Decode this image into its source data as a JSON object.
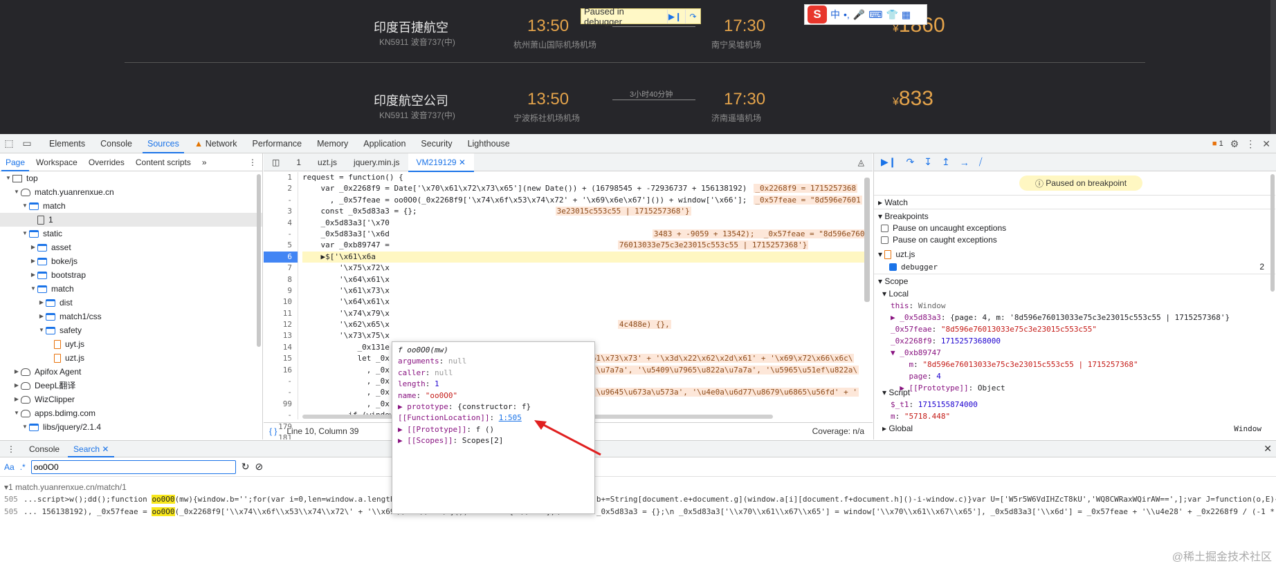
{
  "webpage": {
    "flights": [
      {
        "airline": "印度百捷航空",
        "flight_no": "KN5911 波音737(中)",
        "dep_time": "13:50",
        "dep_airport": "杭州萧山国际机场机场",
        "arr_time": "17:30",
        "arr_airport": "南宁吴墟机场",
        "duration": "",
        "price": "1860"
      },
      {
        "airline": "印度航空公司",
        "flight_no": "KN5911 波音737(中)",
        "dep_time": "13:50",
        "dep_airport": "宁波栎社机场机场",
        "arr_time": "17:30",
        "arr_airport": "济南遥墙机场",
        "duration": "3小时40分钟",
        "price": "833"
      }
    ],
    "price_symbol": "¥",
    "paused_banner": "Paused in debugger",
    "ime": {
      "logo": "S",
      "lang": "中",
      "punct": "•,"
    }
  },
  "devtools": {
    "tabs": [
      "Elements",
      "Console",
      "Sources",
      "Network",
      "Performance",
      "Memory",
      "Application",
      "Security",
      "Lighthouse"
    ],
    "issues_count": "1",
    "nav_tabs": [
      "Page",
      "Workspace",
      "Overrides",
      "Content scripts"
    ],
    "tree": [
      {
        "label": "top",
        "depth": 0,
        "type": "top",
        "open": true
      },
      {
        "label": "match.yuanrenxue.cn",
        "depth": 1,
        "type": "cloud",
        "open": true
      },
      {
        "label": "match",
        "depth": 2,
        "type": "folder",
        "open": true
      },
      {
        "label": "1",
        "depth": 3,
        "type": "file",
        "sel": true
      },
      {
        "label": "static",
        "depth": 2,
        "type": "folder",
        "open": true
      },
      {
        "label": "asset",
        "depth": 3,
        "type": "folder",
        "open": false
      },
      {
        "label": "boke/js",
        "depth": 3,
        "type": "folder",
        "open": false
      },
      {
        "label": "bootstrap",
        "depth": 3,
        "type": "folder",
        "open": false
      },
      {
        "label": "match",
        "depth": 3,
        "type": "folder",
        "open": true
      },
      {
        "label": "dist",
        "depth": 4,
        "type": "folder",
        "open": false
      },
      {
        "label": "match1/css",
        "depth": 4,
        "type": "folder",
        "open": false
      },
      {
        "label": "safety",
        "depth": 4,
        "type": "folder",
        "open": true
      },
      {
        "label": "uyt.js",
        "depth": 5,
        "type": "js"
      },
      {
        "label": "uzt.js",
        "depth": 5,
        "type": "js"
      },
      {
        "label": "Apifox Agent",
        "depth": 1,
        "type": "cloud",
        "open": false
      },
      {
        "label": "DeepL翻译",
        "depth": 1,
        "type": "cloud",
        "open": false
      },
      {
        "label": "WizClipper",
        "depth": 1,
        "type": "cloud",
        "open": false
      },
      {
        "label": "apps.bdimg.com",
        "depth": 1,
        "type": "cloud",
        "open": true
      },
      {
        "label": "libs/jquery/2.1.4",
        "depth": 2,
        "type": "folder",
        "open": true
      }
    ],
    "editor_tabs": [
      "1",
      "uzt.js",
      "jquery.min.js",
      "VM219129"
    ],
    "gutter": [
      "1",
      "2",
      "-",
      "3",
      "4",
      "-",
      "5",
      "6",
      "7",
      "8",
      "9",
      "10",
      "11",
      "12",
      "13",
      "14",
      "15",
      "16",
      "-",
      "-",
      "99",
      "-",
      "179",
      "181",
      "182"
    ],
    "code": [
      "request = function() {",
      "    var _0x2268f9 = Date['\\x70\\x61\\x72\\x73\\x65'](new Date()) + (16798545 + -72936737 + 156138192)",
      "      , _0x57feae = oo0O0(_0x2268f9['\\x74\\x6f\\x53\\x74\\x72' + '\\x69\\x6e\\x67']()) + window['\\x66'];",
      "    const _0x5d83a3 = {};",
      "    _0x5d83a3['\\x70",
      "    _0x5d83a3['\\x6d",
      "    var _0xb89747 =",
      "    ▶$['\\x61\\x6a",
      "        '\\x75\\x72\\x",
      "        '\\x64\\x61\\x",
      "        '\\x61\\x73\\x",
      "        '\\x64\\x61\\x",
      "        '\\x74\\x79\\x",
      "        '\\x62\\x65\\x",
      "        '\\x73\\x75\\x",
      "            _0x131e",
      "            let _0x",
      "              , _0x",
      "              , _0x",
      "              , _0x",
      "              , _0x",
      "          if (window['\\x70\\x61\\x67\\x65']) {} else",
      "              window['\\x70\\x61\\x67\\x65'] = 2333 * 3 + 458 * -5 + -4708;",
      "          $['\\x65\\x61\\x63\\x68'](_0x131e59, function(_0x282f1d, _0x4e0853) {"
    ],
    "inline_values": {
      "l2": "_0x2268f9 = 1715257368",
      "l3": "_0x57feae = \"8d596e7601",
      "l4": "3e23015c553c55 | 1715257368'}",
      "l6": "3483 + -9059 + 13542);  _0x57feae = \"8d596e76013033e75c3c",
      "l7": "76013033e75c3e23015c553c55 | 1715257368'}",
      "l15": "4c488e) {},",
      "l17": "61\\x73\\x73' + '\\x3d\\x22\\x62\\x2d\\x61' + '\\x69\\x72\\x66\\x6c\\",
      "l18": "'\\u7a7a', '\\u5409\\u7965\\u822a\\u7a7a', '\\u5965\\u51ef\\u822a\\",
      "l20": "'\\u9645\\u673a\\u573a', '\\u4e0a\\u6d77\\u8679\\u6865\\u56fd' + '"
    },
    "status": {
      "position": "Line 10, Column 39",
      "coverage": "Coverage: n/a"
    },
    "popover": {
      "header": "f oo0O0(mw)",
      "rows": [
        {
          "key": "arguments",
          "val": "null",
          "kind": "g"
        },
        {
          "key": "caller",
          "val": "null",
          "kind": "g"
        },
        {
          "key": "length",
          "val": "1",
          "kind": "n"
        },
        {
          "key": "name",
          "val": "\"oo0O0\"",
          "kind": "s"
        },
        {
          "key": "▶ prototype",
          "val": "{constructor: f}",
          "kind": "o"
        },
        {
          "key": "[[FunctionLocation]]",
          "val": "1:505",
          "kind": "link"
        },
        {
          "key": "▶ [[Prototype]]",
          "val": "f ()",
          "kind": "o"
        },
        {
          "key": "▶ [[Scopes]]",
          "val": "Scopes[2]",
          "kind": "o"
        }
      ]
    },
    "debugger": {
      "paused": "Paused on breakpoint",
      "watch": "Watch",
      "breakpoints": "Breakpoints",
      "pause_uncaught": "Pause on uncaught exceptions",
      "pause_caught": "Pause on caught exceptions",
      "bp_file": "uzt.js",
      "bp_item": "debugger",
      "bp_line": "2",
      "scope": "Scope",
      "local": "Local",
      "vars": [
        {
          "k": "this",
          "v": "Window",
          "kind": "g"
        },
        {
          "k": "▶ _0x5d83a3",
          "v": "{page: 4, m: '8d596e76013033e75c3e23015c553c55 | 1715257368'}",
          "kind": "o"
        },
        {
          "k": "_0x57feae",
          "v": "\"8d596e76013033e75c3e23015c553c55\"",
          "kind": "s"
        },
        {
          "k": "_0x2268f9",
          "v": "1715257368000",
          "kind": "n"
        },
        {
          "k": "▼ _0xb89747",
          "v": "",
          "kind": "o"
        },
        {
          "k": "    m",
          "v": "\"8d596e76013033e75c3e23015c553c55 | 1715257368\"",
          "kind": "s"
        },
        {
          "k": "    page",
          "v": "4",
          "kind": "n"
        },
        {
          "k": "  ▶ [[Prototype]]",
          "v": "Object",
          "kind": "o"
        }
      ],
      "script": "Script",
      "script_vars": [
        {
          "k": "$_t1",
          "v": "1715155874000",
          "kind": "n"
        },
        {
          "k": "m",
          "v": "\"5718.448\"",
          "kind": "s"
        }
      ],
      "global": "Global",
      "global_val": "Window"
    },
    "drawer": {
      "tabs": [
        "Console",
        "Search"
      ],
      "search_value": "oo0O0",
      "result_file": "match.yuanrenxue.cn/match/1",
      "results": [
        {
          "line": "505",
          "pre": "...script>w();dd();function ",
          "match": "oo0O0",
          "post": "(mw){window.b='';for(var i=0,len=window.a.length;i<len;i++){console.log(window.a[i]);window.b+=String[document.e+document.g](window.a[i][document.f+document.h]()-i-window.c)}var U=['W5r5W6VdIHZcT8kU','WQ8CWRaxWQirAW==',];var J=function(o,E){o=o-0x0;var N=U[o];if(J['bSSGte']===undefined){"
        },
        {
          "line": "505",
          "pre": "... 156138192), _0x57feae = ",
          "match": "oo0O0",
          "post": "(_0x2268f9['\\\\x74\\\\x6f\\\\x53\\\\x74\\\\x72\\' + '\\\\x69\\\\x6e\\\\x67\\']()) + window['\\\\x66'];\\n    const _0x5d83a3 = {};\\n    _0x5d83a3['\\\\x70\\\\x61\\\\x67\\\\x65'] = window['\\\\x70\\\\x61\\\\x67\\\\x65'], _0x5d83a3['\\\\x6d'] = _0x57feae + '\\\\u4e28' + _0x2268f9 / (-1 * 3483 + -9059 + 13542);\\n    var _0xb89747 = _0x5d83"
        }
      ]
    },
    "watermark": "@稀土掘金技术社区"
  }
}
